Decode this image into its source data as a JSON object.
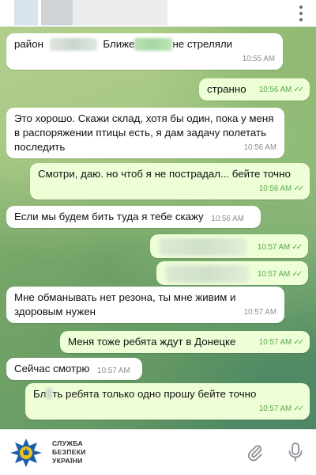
{
  "messages": [
    {
      "id": "m1",
      "dir": "in",
      "text_a": "район",
      "text_b": "Ближе",
      "text_c": "не стреляли",
      "time": "10:55 AM"
    },
    {
      "id": "m2",
      "dir": "out",
      "text": "странно",
      "time": "10:56 AM"
    },
    {
      "id": "m3",
      "dir": "in",
      "text": "Это хорошо. Скажи склад, хотя бы один, пока у меня в распоряжении птицы есть, я дам задачу полетать последить",
      "time": "10:56 AM"
    },
    {
      "id": "m4",
      "dir": "out",
      "text": "Смотри, даю. но чтоб я не пострадал... бейте точно",
      "time": "10:56 AM"
    },
    {
      "id": "m5",
      "dir": "in",
      "text": "Если мы будем бить туда я тебе скажу",
      "time": "10:56 AM"
    },
    {
      "id": "m6",
      "dir": "out",
      "text": "",
      "time": "10:57 AM"
    },
    {
      "id": "m7",
      "dir": "out",
      "text": "",
      "time": "10:57 AM"
    },
    {
      "id": "m8",
      "dir": "in",
      "text": "Мне обманывать нет резона, ты мне живим и здоровым нужен",
      "time": "10:57 AM"
    },
    {
      "id": "m9",
      "dir": "out",
      "text": "Меня тоже ребята ждут в Донецке",
      "time": "10:57 AM"
    },
    {
      "id": "m10",
      "dir": "in",
      "text": "Сейчас смотрю",
      "time": "10:57 AM"
    },
    {
      "id": "m11",
      "dir": "out",
      "text_a": "Бл",
      "text_b": "ть ребята только одно прошу бейте точно",
      "time": "10:57 AM"
    }
  ],
  "watermark": {
    "line1": "СЛУЖБА",
    "line2": "БЕЗПЕКИ",
    "line3": "УКРАЇНИ"
  },
  "icons": {
    "menu": "more-vertical-icon",
    "attach": "paperclip-icon",
    "mic": "microphone-icon",
    "logo": "sbu-emblem"
  },
  "colors": {
    "incoming_bubble": "#ffffff",
    "outgoing_bubble": "#eefed6",
    "read_check": "#56a94c",
    "chat_background": "#6d9a5d"
  }
}
